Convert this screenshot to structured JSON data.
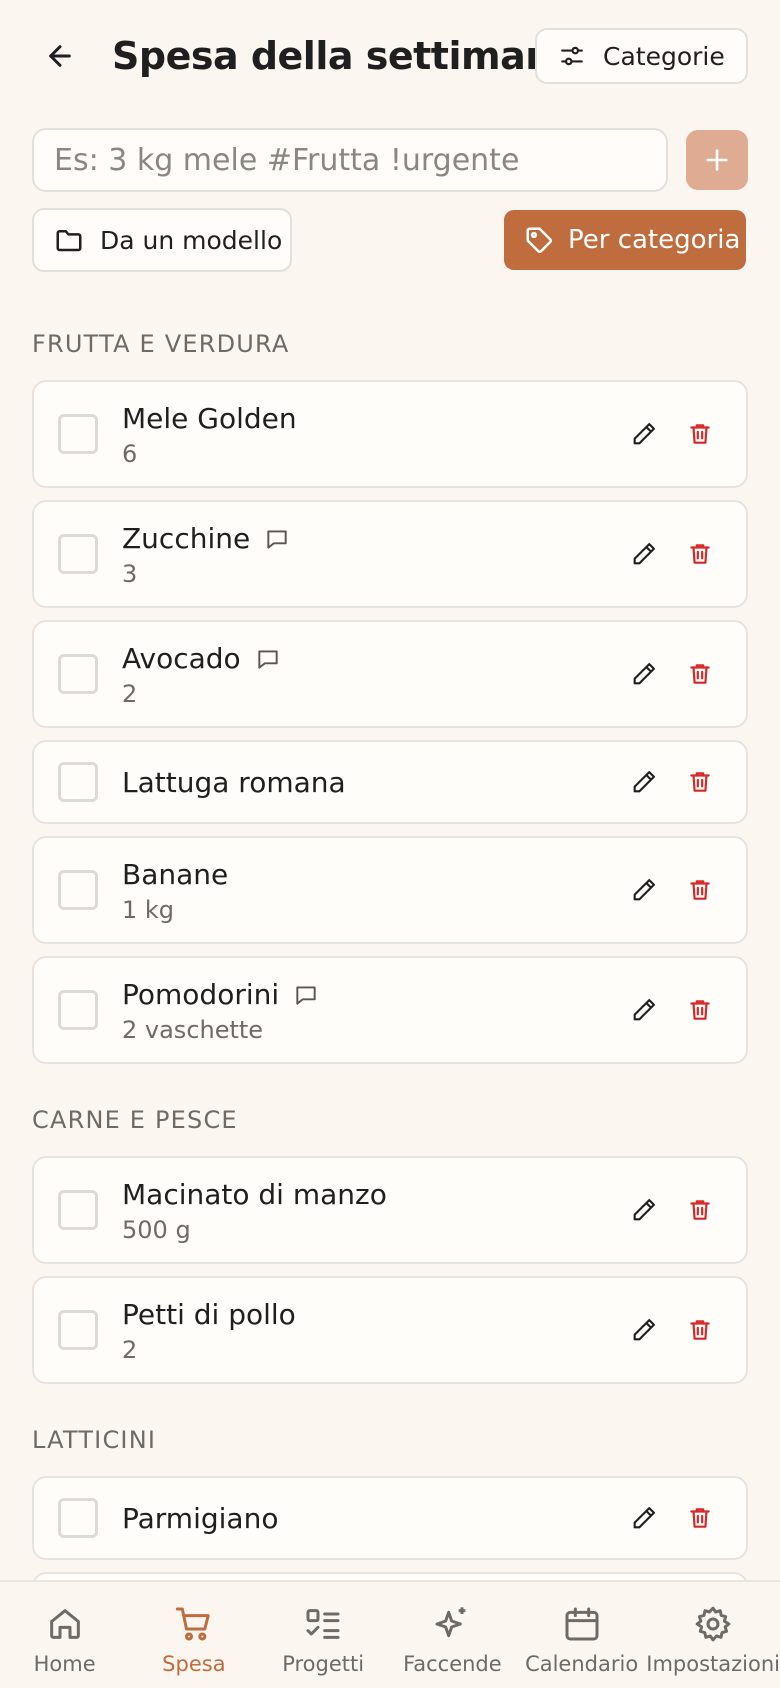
{
  "header": {
    "title": "Spesa della settimana",
    "categories_label": "Categorie"
  },
  "add": {
    "placeholder": "Es: 3 kg mele #Frutta !urgente",
    "template_label": "Da un modello",
    "by_category_label": "Per categoria"
  },
  "sections": [
    {
      "title": "FRUTTA E VERDURA",
      "items": [
        {
          "name": "Mele Golden",
          "qty": "6",
          "note": false
        },
        {
          "name": "Zucchine",
          "qty": "3",
          "note": true
        },
        {
          "name": "Avocado",
          "qty": "2",
          "note": true
        },
        {
          "name": "Lattuga romana",
          "qty": "",
          "note": false
        },
        {
          "name": "Banane",
          "qty": "1 kg",
          "note": false
        },
        {
          "name": "Pomodorini",
          "qty": "2 vaschette",
          "note": true
        }
      ]
    },
    {
      "title": "CARNE E PESCE",
      "items": [
        {
          "name": "Macinato di manzo",
          "qty": "500 g",
          "note": false
        },
        {
          "name": "Petti di pollo",
          "qty": "2",
          "note": false
        }
      ]
    },
    {
      "title": "LATTICINI",
      "items": [
        {
          "name": "Parmigiano",
          "qty": "",
          "note": false
        }
      ]
    }
  ],
  "nav": [
    {
      "label": "Home",
      "icon": "home-icon",
      "active": false
    },
    {
      "label": "Spesa",
      "icon": "cart-icon",
      "active": true
    },
    {
      "label": "Progetti",
      "icon": "checklist-icon",
      "active": false
    },
    {
      "label": "Faccende",
      "icon": "sparkles-icon",
      "active": false
    },
    {
      "label": "Calendario",
      "icon": "calendar-icon",
      "active": false
    },
    {
      "label": "Impostazioni",
      "icon": "settings-icon",
      "active": false
    }
  ],
  "colors": {
    "accent": "#bf6c3f",
    "accent_light": "#dfab93",
    "delete": "#d62828",
    "background": "#fcf6f1"
  }
}
